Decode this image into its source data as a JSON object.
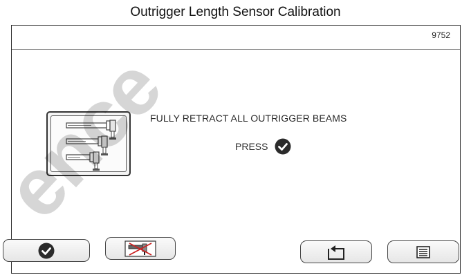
{
  "caption": "Outrigger Length Sensor Calibration",
  "screen": {
    "code": "9752",
    "instruction": "FULLY RETRACT ALL OUTRIGGER BEAMS",
    "press_label": "PRESS"
  },
  "icons": {
    "outrigger_graphic": "outriggers-retracted-icon",
    "press_check": "check-circle-icon",
    "confirm": "check-circle-icon",
    "disabled_function": "outrigger-crossed-icon",
    "back": "return-arrow-icon",
    "menu": "menu-icon"
  },
  "watermark": "ence"
}
